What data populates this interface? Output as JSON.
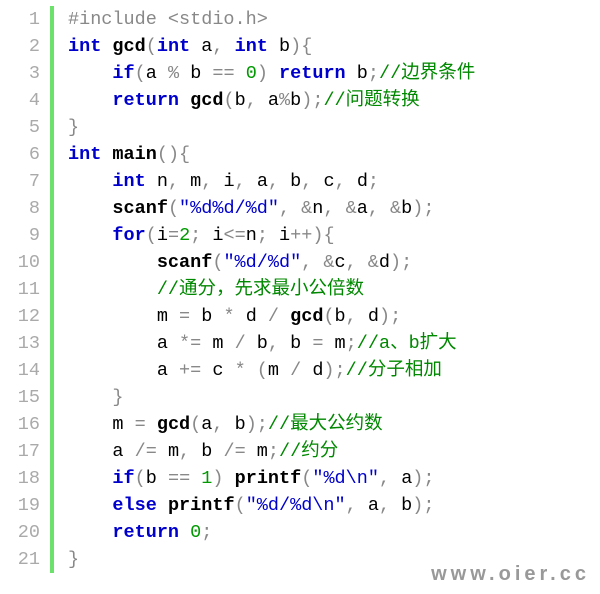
{
  "watermark": "www.oier.cc",
  "lines": [
    {
      "n": "1",
      "tokens": [
        {
          "c": "pp",
          "t": "#include <stdio.h>"
        }
      ]
    },
    {
      "n": "2",
      "tokens": [
        {
          "c": "kw",
          "t": "int"
        },
        {
          "c": "id",
          "t": " "
        },
        {
          "c": "fn",
          "t": "gcd"
        },
        {
          "c": "op",
          "t": "("
        },
        {
          "c": "kw",
          "t": "int"
        },
        {
          "c": "id",
          "t": " a"
        },
        {
          "c": "op",
          "t": ", "
        },
        {
          "c": "kw",
          "t": "int"
        },
        {
          "c": "id",
          "t": " b"
        },
        {
          "c": "op",
          "t": "){"
        }
      ]
    },
    {
      "n": "3",
      "tokens": [
        {
          "c": "id",
          "t": "    "
        },
        {
          "c": "kw",
          "t": "if"
        },
        {
          "c": "op",
          "t": "("
        },
        {
          "c": "id",
          "t": "a "
        },
        {
          "c": "op",
          "t": "% "
        },
        {
          "c": "id",
          "t": "b "
        },
        {
          "c": "op",
          "t": "== "
        },
        {
          "c": "num",
          "t": "0"
        },
        {
          "c": "op",
          "t": ") "
        },
        {
          "c": "kw",
          "t": "return"
        },
        {
          "c": "id",
          "t": " b"
        },
        {
          "c": "op",
          "t": ";"
        },
        {
          "c": "cm",
          "t": "//边界条件"
        }
      ]
    },
    {
      "n": "4",
      "tokens": [
        {
          "c": "id",
          "t": "    "
        },
        {
          "c": "kw",
          "t": "return"
        },
        {
          "c": "id",
          "t": " "
        },
        {
          "c": "fn",
          "t": "gcd"
        },
        {
          "c": "op",
          "t": "("
        },
        {
          "c": "id",
          "t": "b"
        },
        {
          "c": "op",
          "t": ", "
        },
        {
          "c": "id",
          "t": "a"
        },
        {
          "c": "op",
          "t": "%"
        },
        {
          "c": "id",
          "t": "b"
        },
        {
          "c": "op",
          "t": ");"
        },
        {
          "c": "cm",
          "t": "//问题转换"
        }
      ]
    },
    {
      "n": "5",
      "tokens": [
        {
          "c": "op",
          "t": "}"
        }
      ]
    },
    {
      "n": "6",
      "tokens": [
        {
          "c": "kw",
          "t": "int"
        },
        {
          "c": "id",
          "t": " "
        },
        {
          "c": "fn",
          "t": "main"
        },
        {
          "c": "op",
          "t": "(){"
        }
      ]
    },
    {
      "n": "7",
      "tokens": [
        {
          "c": "id",
          "t": "    "
        },
        {
          "c": "kw",
          "t": "int"
        },
        {
          "c": "id",
          "t": " n"
        },
        {
          "c": "op",
          "t": ", "
        },
        {
          "c": "id",
          "t": "m"
        },
        {
          "c": "op",
          "t": ", "
        },
        {
          "c": "id",
          "t": "i"
        },
        {
          "c": "op",
          "t": ", "
        },
        {
          "c": "id",
          "t": "a"
        },
        {
          "c": "op",
          "t": ", "
        },
        {
          "c": "id",
          "t": "b"
        },
        {
          "c": "op",
          "t": ", "
        },
        {
          "c": "id",
          "t": "c"
        },
        {
          "c": "op",
          "t": ", "
        },
        {
          "c": "id",
          "t": "d"
        },
        {
          "c": "op",
          "t": ";"
        }
      ]
    },
    {
      "n": "8",
      "tokens": [
        {
          "c": "id",
          "t": "    "
        },
        {
          "c": "fn",
          "t": "scanf"
        },
        {
          "c": "op",
          "t": "("
        },
        {
          "c": "str",
          "t": "\"%d%d/%d\""
        },
        {
          "c": "op",
          "t": ", &"
        },
        {
          "c": "id",
          "t": "n"
        },
        {
          "c": "op",
          "t": ", &"
        },
        {
          "c": "id",
          "t": "a"
        },
        {
          "c": "op",
          "t": ", &"
        },
        {
          "c": "id",
          "t": "b"
        },
        {
          "c": "op",
          "t": ");"
        }
      ]
    },
    {
      "n": "9",
      "tokens": [
        {
          "c": "id",
          "t": "    "
        },
        {
          "c": "kw",
          "t": "for"
        },
        {
          "c": "op",
          "t": "("
        },
        {
          "c": "id",
          "t": "i"
        },
        {
          "c": "op",
          "t": "="
        },
        {
          "c": "num",
          "t": "2"
        },
        {
          "c": "op",
          "t": "; "
        },
        {
          "c": "id",
          "t": "i"
        },
        {
          "c": "op",
          "t": "<="
        },
        {
          "c": "id",
          "t": "n"
        },
        {
          "c": "op",
          "t": "; "
        },
        {
          "c": "id",
          "t": "i"
        },
        {
          "c": "op",
          "t": "++){"
        }
      ]
    },
    {
      "n": "10",
      "tokens": [
        {
          "c": "id",
          "t": "        "
        },
        {
          "c": "fn",
          "t": "scanf"
        },
        {
          "c": "op",
          "t": "("
        },
        {
          "c": "str",
          "t": "\"%d/%d\""
        },
        {
          "c": "op",
          "t": ", &"
        },
        {
          "c": "id",
          "t": "c"
        },
        {
          "c": "op",
          "t": ", &"
        },
        {
          "c": "id",
          "t": "d"
        },
        {
          "c": "op",
          "t": ");"
        }
      ]
    },
    {
      "n": "11",
      "tokens": [
        {
          "c": "id",
          "t": "        "
        },
        {
          "c": "cm",
          "t": "//通分，先求最小公倍数"
        }
      ]
    },
    {
      "n": "12",
      "tokens": [
        {
          "c": "id",
          "t": "        m "
        },
        {
          "c": "op",
          "t": "= "
        },
        {
          "c": "id",
          "t": "b "
        },
        {
          "c": "op",
          "t": "* "
        },
        {
          "c": "id",
          "t": "d "
        },
        {
          "c": "op",
          "t": "/ "
        },
        {
          "c": "fn",
          "t": "gcd"
        },
        {
          "c": "op",
          "t": "("
        },
        {
          "c": "id",
          "t": "b"
        },
        {
          "c": "op",
          "t": ", "
        },
        {
          "c": "id",
          "t": "d"
        },
        {
          "c": "op",
          "t": ");"
        }
      ]
    },
    {
      "n": "13",
      "tokens": [
        {
          "c": "id",
          "t": "        a "
        },
        {
          "c": "op",
          "t": "*= "
        },
        {
          "c": "id",
          "t": "m "
        },
        {
          "c": "op",
          "t": "/ "
        },
        {
          "c": "id",
          "t": "b"
        },
        {
          "c": "op",
          "t": ", "
        },
        {
          "c": "id",
          "t": "b "
        },
        {
          "c": "op",
          "t": "= "
        },
        {
          "c": "id",
          "t": "m"
        },
        {
          "c": "op",
          "t": ";"
        },
        {
          "c": "cm",
          "t": "//a、b扩大"
        }
      ]
    },
    {
      "n": "14",
      "tokens": [
        {
          "c": "id",
          "t": "        a "
        },
        {
          "c": "op",
          "t": "+= "
        },
        {
          "c": "id",
          "t": "c "
        },
        {
          "c": "op",
          "t": "* ("
        },
        {
          "c": "id",
          "t": "m "
        },
        {
          "c": "op",
          "t": "/ "
        },
        {
          "c": "id",
          "t": "d"
        },
        {
          "c": "op",
          "t": ");"
        },
        {
          "c": "cm",
          "t": "//分子相加"
        }
      ]
    },
    {
      "n": "15",
      "tokens": [
        {
          "c": "id",
          "t": "    "
        },
        {
          "c": "op",
          "t": "}"
        }
      ]
    },
    {
      "n": "16",
      "tokens": [
        {
          "c": "id",
          "t": "    m "
        },
        {
          "c": "op",
          "t": "= "
        },
        {
          "c": "fn",
          "t": "gcd"
        },
        {
          "c": "op",
          "t": "("
        },
        {
          "c": "id",
          "t": "a"
        },
        {
          "c": "op",
          "t": ", "
        },
        {
          "c": "id",
          "t": "b"
        },
        {
          "c": "op",
          "t": ");"
        },
        {
          "c": "cm",
          "t": "//最大公约数"
        }
      ]
    },
    {
      "n": "17",
      "tokens": [
        {
          "c": "id",
          "t": "    a "
        },
        {
          "c": "op",
          "t": "/= "
        },
        {
          "c": "id",
          "t": "m"
        },
        {
          "c": "op",
          "t": ", "
        },
        {
          "c": "id",
          "t": "b "
        },
        {
          "c": "op",
          "t": "/= "
        },
        {
          "c": "id",
          "t": "m"
        },
        {
          "c": "op",
          "t": ";"
        },
        {
          "c": "cm",
          "t": "//约分"
        }
      ]
    },
    {
      "n": "18",
      "tokens": [
        {
          "c": "id",
          "t": "    "
        },
        {
          "c": "kw",
          "t": "if"
        },
        {
          "c": "op",
          "t": "("
        },
        {
          "c": "id",
          "t": "b "
        },
        {
          "c": "op",
          "t": "== "
        },
        {
          "c": "num",
          "t": "1"
        },
        {
          "c": "op",
          "t": ") "
        },
        {
          "c": "fn",
          "t": "printf"
        },
        {
          "c": "op",
          "t": "("
        },
        {
          "c": "str",
          "t": "\"%d\\n\""
        },
        {
          "c": "op",
          "t": ", "
        },
        {
          "c": "id",
          "t": "a"
        },
        {
          "c": "op",
          "t": ");"
        }
      ]
    },
    {
      "n": "19",
      "tokens": [
        {
          "c": "id",
          "t": "    "
        },
        {
          "c": "kw",
          "t": "else"
        },
        {
          "c": "id",
          "t": " "
        },
        {
          "c": "fn",
          "t": "printf"
        },
        {
          "c": "op",
          "t": "("
        },
        {
          "c": "str",
          "t": "\"%d/%d\\n\""
        },
        {
          "c": "op",
          "t": ", "
        },
        {
          "c": "id",
          "t": "a"
        },
        {
          "c": "op",
          "t": ", "
        },
        {
          "c": "id",
          "t": "b"
        },
        {
          "c": "op",
          "t": ");"
        }
      ]
    },
    {
      "n": "20",
      "tokens": [
        {
          "c": "id",
          "t": "    "
        },
        {
          "c": "kw",
          "t": "return"
        },
        {
          "c": "id",
          "t": " "
        },
        {
          "c": "num",
          "t": "0"
        },
        {
          "c": "op",
          "t": ";"
        }
      ]
    },
    {
      "n": "21",
      "tokens": [
        {
          "c": "op",
          "t": "}"
        }
      ]
    }
  ]
}
